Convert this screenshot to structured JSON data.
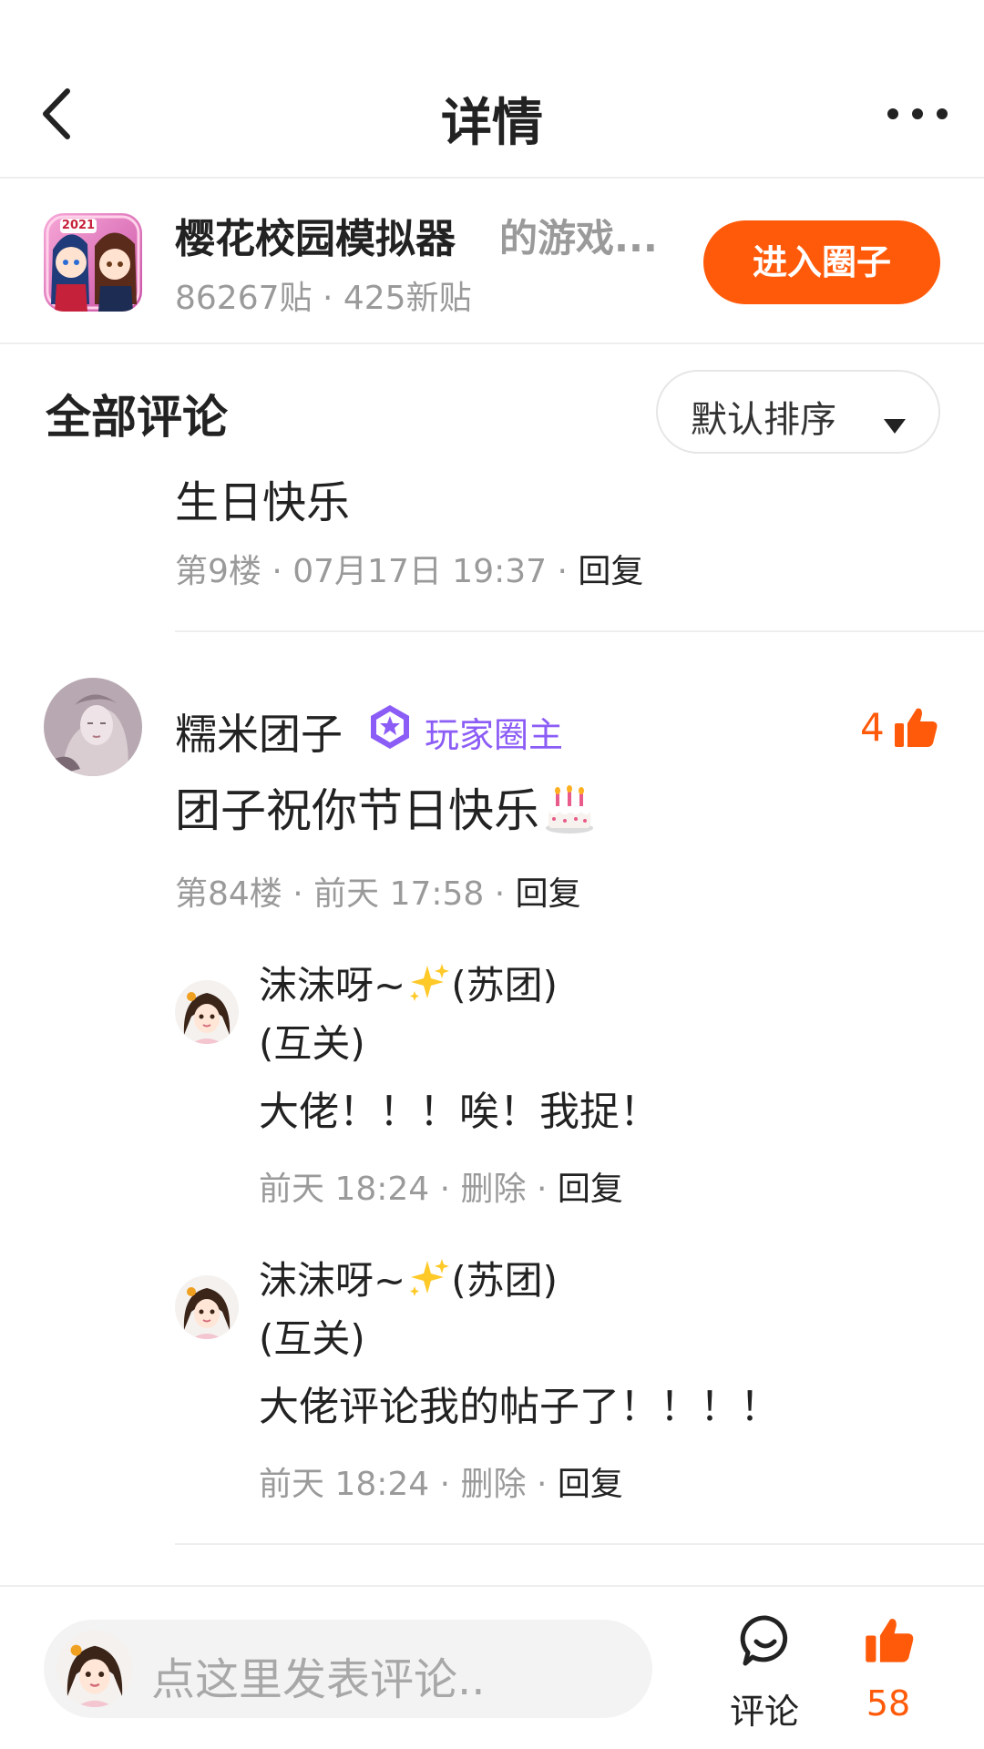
{
  "header": {
    "title": "详情",
    "back_icon": "chevron-left-icon",
    "more_icon": "more-dots-icon"
  },
  "circle": {
    "name": "樱花校园模拟器",
    "suffix": "的游戏...",
    "stats": "86267贴 · 425新贴",
    "enter_label": "进入圈子",
    "icon_year": "2021",
    "accent_color": "#ff5a0a"
  },
  "comments": {
    "title": "全部评论",
    "sort_label": "默认排序"
  },
  "previous_comment": {
    "partial_text": "生日快乐",
    "meta": "第9楼 · 07月17日 19:37 · ",
    "reply_label": "回复"
  },
  "main_comment": {
    "username": "糯米团子",
    "badge_label": "玩家圈主",
    "badge_color": "#8b5cf6",
    "likes": "4",
    "text": "团子祝你节日快乐",
    "meta": "第84楼 · 前天 17:58 · ",
    "reply_label": "回复"
  },
  "replies": [
    {
      "name_a": "沫沫呀~",
      "name_b": "(苏团)",
      "name_c": "(互关)",
      "text": "大佬！！！唉！我捉！",
      "meta": "前天 18:24 · 删除 · ",
      "reply_label": "回复"
    },
    {
      "name_a": "沫沫呀~",
      "name_b": "(苏团)",
      "name_c": "(互关)",
      "text": "大佬评论我的帖子了！！！！",
      "meta": "前天 18:24 · 删除 · ",
      "reply_label": "回复"
    }
  ],
  "bottom_bar": {
    "placeholder": "点这里发表评论..",
    "comment_label": "评论",
    "like_count": "58"
  }
}
